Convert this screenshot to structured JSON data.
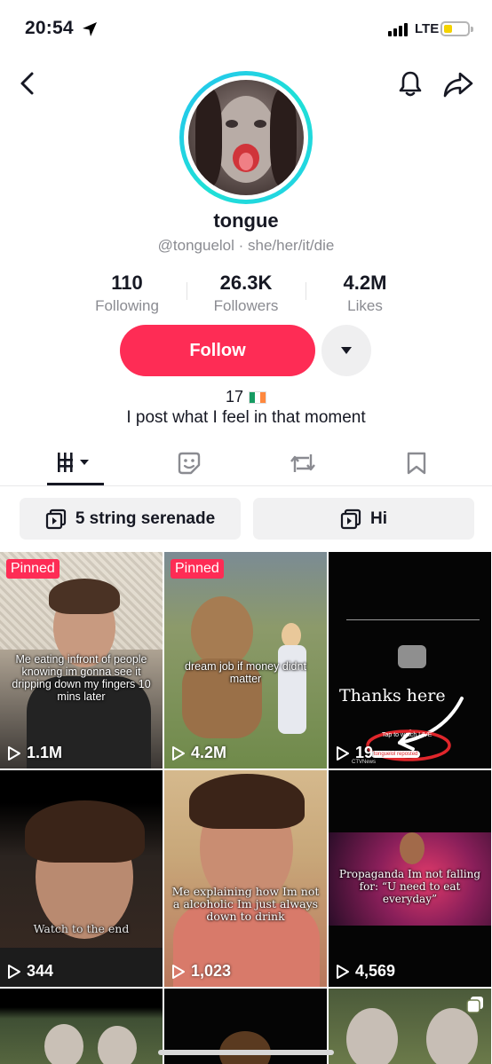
{
  "status_bar": {
    "time": "20:54",
    "network": "LTE"
  },
  "profile": {
    "display_name": "tongue",
    "handle": "@tonguelol",
    "pronouns": "she/her/it/die",
    "handle_line": "@tonguelol · she/her/it/die",
    "stats": [
      {
        "value": "110",
        "label": "Following"
      },
      {
        "value": "26.3K",
        "label": "Followers"
      },
      {
        "value": "4.2M",
        "label": "Likes"
      }
    ],
    "follow_label": "Follow",
    "bio_age": "17",
    "bio_text": "I post what I feel in that moment"
  },
  "tabs": [
    "videos-tab",
    "favorites-tab",
    "reposts-tab",
    "saved-tab"
  ],
  "playlists": [
    {
      "label": "5 string serenade"
    },
    {
      "label": "Hi"
    }
  ],
  "videos": [
    {
      "pinned": "Pinned",
      "views": "1.1M",
      "caption": "Me eating infront of people knowing im gonna see it dripping down my fingers 10 mins later"
    },
    {
      "pinned": "Pinned",
      "views": "4.2M",
      "caption": "dream job if money didnt matter"
    },
    {
      "views": "19",
      "caption": "Thanks here",
      "overlay_text": "Tap to watch LIVE",
      "overlay_source": "CTVNews",
      "overlay_tag": "tonguelol reposted"
    },
    {
      "views": "344",
      "caption": "Watch to the end"
    },
    {
      "views": "1,023",
      "caption": "Me explaining how Im not a alcoholic Im just always down to drink"
    },
    {
      "views": "4,569",
      "caption": "Propaganda Im not falling for: “U need to eat everyday”"
    }
  ],
  "colors": {
    "accent": "#fe2c55",
    "ring_start": "#25c3f0",
    "ring_end": "#1fe0d6",
    "muted_text": "#8a8b91"
  }
}
